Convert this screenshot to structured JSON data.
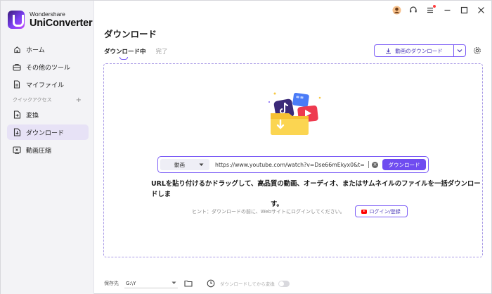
{
  "app": {
    "brand": "Wondershare",
    "product": "UniConverter"
  },
  "sidebar": {
    "items": [
      {
        "label": "ホーム",
        "icon": "home-icon"
      },
      {
        "label": "その他のツール",
        "icon": "toolbox-icon"
      },
      {
        "label": "マイファイル",
        "icon": "file-icon"
      }
    ],
    "section_label": "クイックアクセス",
    "section_plus": "+",
    "quick_items": [
      {
        "label": "変換",
        "icon": "convert-icon"
      },
      {
        "label": "ダウンロード",
        "icon": "download-icon",
        "active": true
      },
      {
        "label": "動画圧縮",
        "icon": "compress-icon"
      }
    ]
  },
  "header": {
    "title": "ダウンロード"
  },
  "tabs": [
    {
      "label": "ダウンロード中",
      "active": true
    },
    {
      "label": "完了",
      "active": false
    }
  ],
  "toolbar": {
    "download_video_label": "動画のダウンロード"
  },
  "url_bar": {
    "type_value": "動画",
    "url_value": "https://www.youtube.com/watch?v=Dse66mEkyx0&t=",
    "download_label": "ダウンロード"
  },
  "main": {
    "instruction_line1": "URLを貼り付けるかドラッグして、高品質の動画、オーディオ、またはサムネイルのファイルを一括ダウンロードしま",
    "instruction_line2": "す。",
    "hint": "ヒント：ダウンロードの前に、Webサイトにログインしてください。",
    "login_label": "ログイン/登録"
  },
  "footer": {
    "location_label": "保存先",
    "location_value": "G:\\Y",
    "convert_after_label": "ダウンロードしてから変換"
  },
  "colors": {
    "accent": "#6f4cf0",
    "sidebar_bg": "#f3f3f6",
    "active_item_bg": "#e7e2f6"
  }
}
